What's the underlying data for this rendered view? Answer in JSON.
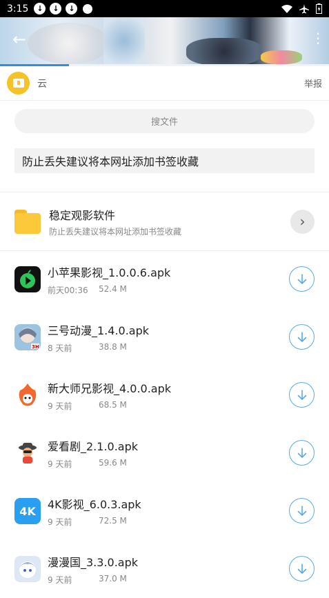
{
  "status_bar": {
    "time": "3:15",
    "download_icons": [
      "download-icon",
      "download-icon",
      "download-icon"
    ]
  },
  "banner": {
    "progress_fraction": 0.21
  },
  "owner": {
    "name": "云",
    "report_label": "举报"
  },
  "search": {
    "placeholder": "搜文件"
  },
  "notice": {
    "text": "防止丢失建议将本网址添加书签收藏"
  },
  "folder": {
    "title": "稳定观影软件",
    "subtitle": "防止丢失建议将本网址添加书签收藏"
  },
  "files": [
    {
      "name": "小苹果影视_1.0.0.6.apk",
      "time": "前天00:36",
      "size": "52.4 M",
      "icon": "apple-play-icon",
      "icon_bg": "#111111"
    },
    {
      "name": "三号动漫_1.4.0.apk",
      "time": "8 天前",
      "size": "38.8 M",
      "icon": "anime-girl-icon",
      "icon_bg": "#9cc4e0"
    },
    {
      "name": "新大师兄影视_4.0.0.apk",
      "time": "9 天前",
      "size": "68.5 M",
      "icon": "monkey-flame-icon",
      "icon_bg": "#ffffff"
    },
    {
      "name": "爱看剧_2.1.0.apk",
      "time": "9 天前",
      "size": "59.6 M",
      "icon": "cowboy-character-icon",
      "icon_bg": "#ffffff"
    },
    {
      "name": "4K影视_6.0.3.apk",
      "time": "9 天前",
      "size": "72.5 M",
      "icon": "4k-icon",
      "icon_bg": "#2a9ff0",
      "icon_text": "4K"
    },
    {
      "name": "漫漫国_3.3.0.apk",
      "time": "9 天前",
      "size": "37.0 M",
      "icon": "anime-chibi-icon",
      "icon_bg": "#dde8f4"
    }
  ]
}
